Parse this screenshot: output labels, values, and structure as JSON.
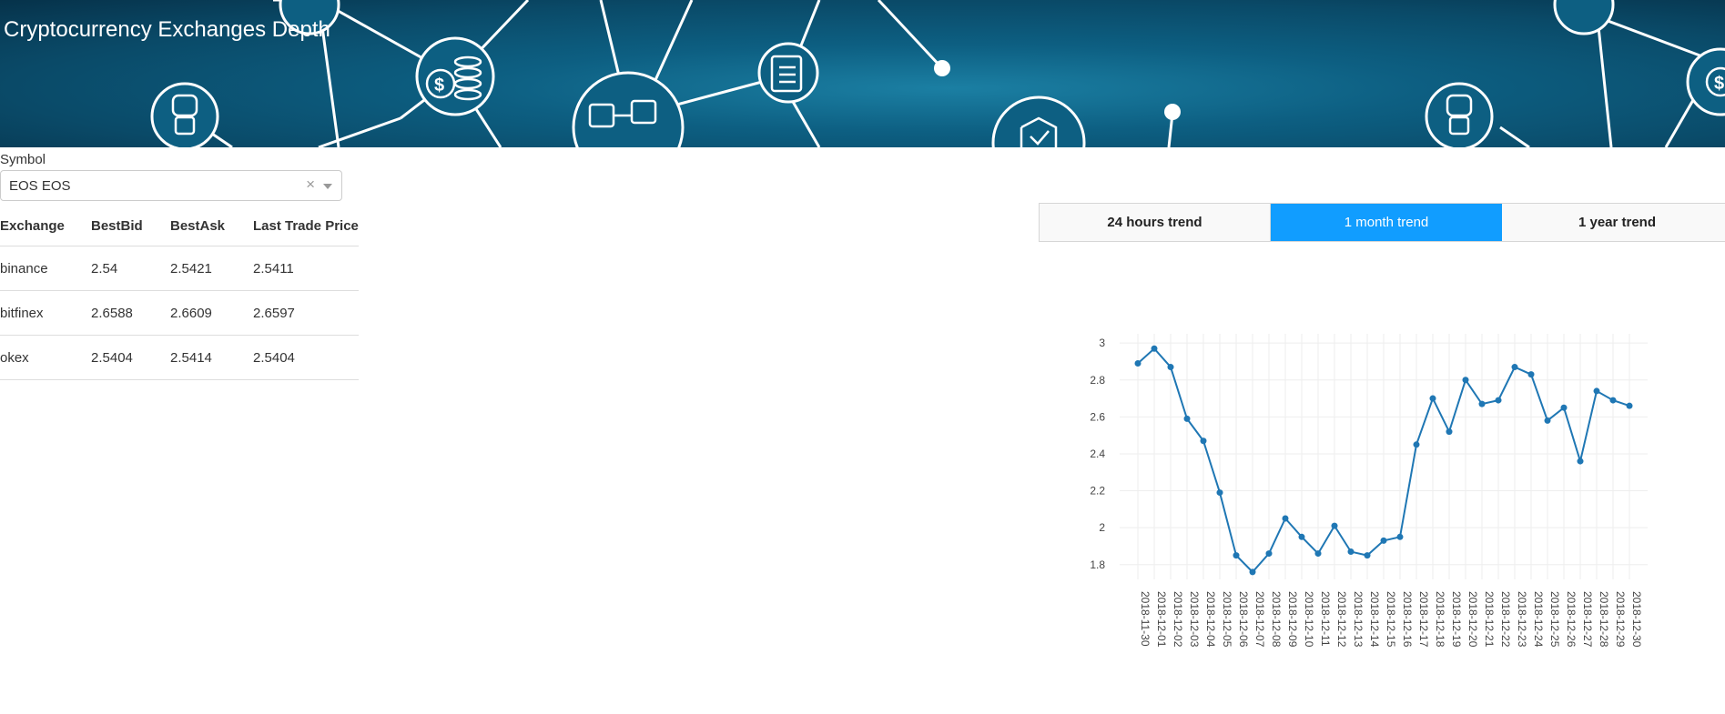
{
  "header": {
    "title": "Cryptocurrency Exchanges Depth"
  },
  "symbol": {
    "label": "Symbol",
    "value": "EOS EOS",
    "clear": "×"
  },
  "table": {
    "columns": [
      "Exchange",
      "BestBid",
      "BestAsk",
      "Last Trade Price"
    ],
    "rows": [
      [
        "binance",
        "2.54",
        "2.5421",
        "2.5411"
      ],
      [
        "bitfinex",
        "2.6588",
        "2.6609",
        "2.6597"
      ],
      [
        "okex",
        "2.5404",
        "2.5414",
        "2.5404"
      ]
    ]
  },
  "tabs": [
    {
      "label": "24 hours trend",
      "active": false
    },
    {
      "label": "1 month trend",
      "active": true
    },
    {
      "label": "1 year trend",
      "active": false
    }
  ],
  "colors": {
    "accent": "#119dff",
    "banner": "#0d5f82",
    "line": "#1f77b4"
  },
  "chart_data": {
    "type": "line",
    "x": [
      "2018-11-30",
      "2018-12-01",
      "2018-12-02",
      "2018-12-03",
      "2018-12-04",
      "2018-12-05",
      "2018-12-06",
      "2018-12-07",
      "2018-12-08",
      "2018-12-09",
      "2018-12-10",
      "2018-12-11",
      "2018-12-12",
      "2018-12-13",
      "2018-12-14",
      "2018-12-15",
      "2018-12-16",
      "2018-12-17",
      "2018-12-18",
      "2018-12-19",
      "2018-12-20",
      "2018-12-21",
      "2018-12-22",
      "2018-12-23",
      "2018-12-24",
      "2018-12-25",
      "2018-12-26",
      "2018-12-27",
      "2018-12-28",
      "2018-12-29",
      "2018-12-30"
    ],
    "values": [
      2.89,
      2.97,
      2.87,
      2.59,
      2.47,
      2.19,
      1.85,
      1.76,
      1.86,
      2.05,
      1.95,
      1.86,
      2.01,
      1.87,
      1.85,
      1.93,
      1.95,
      2.45,
      2.7,
      2.52,
      2.8,
      2.67,
      2.69,
      2.87,
      2.83,
      2.58,
      2.65,
      2.36,
      2.74,
      2.69,
      2.66
    ],
    "yticks": [
      "1.8",
      "2",
      "2.2",
      "2.4",
      "2.6",
      "2.8",
      "3"
    ],
    "ylim": [
      1.72,
      3.05
    ],
    "grid": true
  }
}
